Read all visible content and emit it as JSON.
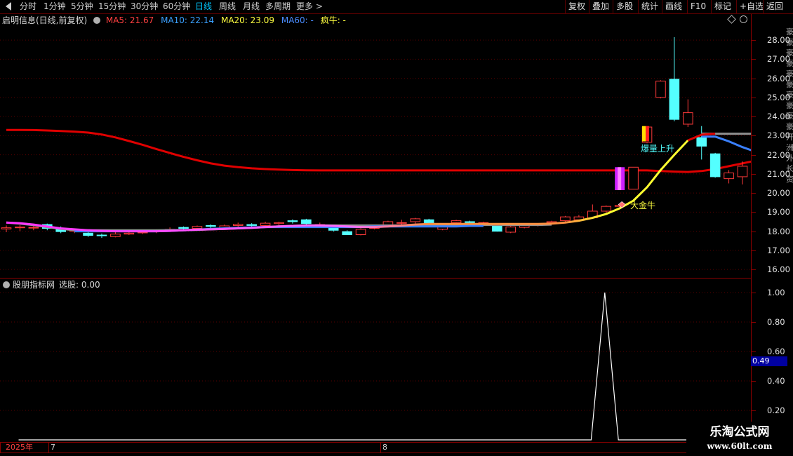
{
  "toolbar": {
    "periods": [
      {
        "label": "分时"
      },
      {
        "label": "1分钟"
      },
      {
        "label": "5分钟"
      },
      {
        "label": "15分钟"
      },
      {
        "label": "30分钟"
      },
      {
        "label": "60分钟"
      },
      {
        "label": "日线",
        "active": true
      },
      {
        "label": "周线"
      },
      {
        "label": "月线"
      },
      {
        "label": "多周期"
      },
      {
        "label": "更多 >"
      }
    ],
    "right_buttons": [
      "复权",
      "叠加",
      "多股",
      "统计",
      "画线",
      "F10",
      "标记",
      "+自选",
      "返回"
    ]
  },
  "header": {
    "stock": "启明信息(日线,前复权)",
    "ma5": "MA5: 21.67",
    "ma10": "MA10: 22.14",
    "ma20": "MA20: 23.09",
    "ma60": "MA60: -",
    "indicator": "疯牛: -"
  },
  "price_axis": {
    "labels": [
      "28.00",
      "27.00",
      "26.00",
      "25.00",
      "24.00",
      "23.00",
      "22.00",
      "21.00",
      "20.00",
      "19.00",
      "18.00",
      "17.00",
      "16.00"
    ]
  },
  "annotations": {
    "baoliang": "爆量上升",
    "dajinniu": "大金牛"
  },
  "sub_panel": {
    "title": "股朋指标网",
    "value_text": "选股: 0.00",
    "axis_labels": [
      "1.00",
      "0.80",
      "0.60",
      "0.40",
      "0.20"
    ],
    "current_value": "0.49"
  },
  "date_axis": {
    "year": "2025年",
    "months": [
      "7",
      "8"
    ]
  },
  "watermark": {
    "line1": "乐淘公式网",
    "line2": "www.60lt.com"
  },
  "colors": {
    "up": "#ff3a3a",
    "down": "#54ffff",
    "ma_long": "#e00000",
    "signal_line": "#ffffff"
  },
  "chart_data": {
    "type": "candlestick",
    "ylim": [
      15.6,
      28.7
    ],
    "candles": [
      {
        "o": 18.12,
        "c": 18.18,
        "h": 18.3,
        "l": 17.95
      },
      {
        "o": 18.18,
        "c": 18.22,
        "h": 18.32,
        "l": 18.0
      },
      {
        "o": 18.2,
        "c": 18.2,
        "h": 18.35,
        "l": 18.05
      },
      {
        "o": 18.35,
        "c": 18.15,
        "h": 18.4,
        "l": 18.05
      },
      {
        "o": 18.15,
        "c": 17.98,
        "h": 18.25,
        "l": 17.9
      },
      {
        "o": 18.0,
        "c": 18.05,
        "h": 18.15,
        "l": 17.9
      },
      {
        "o": 17.9,
        "c": 17.78,
        "h": 17.95,
        "l": 17.7
      },
      {
        "o": 17.8,
        "c": 17.78,
        "h": 17.88,
        "l": 17.65
      },
      {
        "o": 17.72,
        "c": 17.85,
        "h": 17.95,
        "l": 17.68
      },
      {
        "o": 17.85,
        "c": 17.9,
        "h": 18.0,
        "l": 17.8
      },
      {
        "o": 17.95,
        "c": 17.95,
        "h": 18.05,
        "l": 17.85
      },
      {
        "o": 17.97,
        "c": 18.02,
        "h": 18.1,
        "l": 17.9
      },
      {
        "o": 18.05,
        "c": 18.1,
        "h": 18.2,
        "l": 17.98
      },
      {
        "o": 18.2,
        "c": 18.15,
        "h": 18.25,
        "l": 18.05
      },
      {
        "o": 18.15,
        "c": 18.25,
        "h": 18.3,
        "l": 18.1
      },
      {
        "o": 18.3,
        "c": 18.25,
        "h": 18.36,
        "l": 18.15
      },
      {
        "o": 18.15,
        "c": 18.28,
        "h": 18.35,
        "l": 18.1
      },
      {
        "o": 18.3,
        "c": 18.36,
        "h": 18.45,
        "l": 18.2
      },
      {
        "o": 18.35,
        "c": 18.3,
        "h": 18.42,
        "l": 18.2
      },
      {
        "o": 18.3,
        "c": 18.42,
        "h": 18.5,
        "l": 18.2
      },
      {
        "o": 18.4,
        "c": 18.45,
        "h": 18.5,
        "l": 18.3
      },
      {
        "o": 18.55,
        "c": 18.5,
        "h": 18.62,
        "l": 18.4
      },
      {
        "o": 18.6,
        "c": 18.4,
        "h": 18.65,
        "l": 18.35
      },
      {
        "o": 18.3,
        "c": 18.35,
        "h": 18.45,
        "l": 18.2
      },
      {
        "o": 18.2,
        "c": 18.05,
        "h": 18.25,
        "l": 17.98
      },
      {
        "o": 17.98,
        "c": 17.82,
        "h": 18.05,
        "l": 17.8
      },
      {
        "o": 17.82,
        "c": 18.1,
        "h": 18.15,
        "l": 17.78
      },
      {
        "o": 18.15,
        "c": 18.3,
        "h": 18.35,
        "l": 18.1
      },
      {
        "o": 18.32,
        "c": 18.5,
        "h": 18.55,
        "l": 18.25
      },
      {
        "o": 18.45,
        "c": 18.45,
        "h": 18.6,
        "l": 18.35
      },
      {
        "o": 18.5,
        "c": 18.65,
        "h": 18.7,
        "l": 18.4
      },
      {
        "o": 18.6,
        "c": 18.35,
        "h": 18.65,
        "l": 18.3
      },
      {
        "o": 18.1,
        "c": 18.3,
        "h": 18.4,
        "l": 18.05
      },
      {
        "o": 18.45,
        "c": 18.55,
        "h": 18.6,
        "l": 18.35
      },
      {
        "o": 18.5,
        "c": 18.45,
        "h": 18.55,
        "l": 18.35
      },
      {
        "o": 18.45,
        "c": 18.45,
        "h": 18.5,
        "l": 18.35
      },
      {
        "o": 18.3,
        "c": 18.0,
        "h": 18.35,
        "l": 17.98
      },
      {
        "o": 17.95,
        "c": 18.22,
        "h": 18.3,
        "l": 17.9
      },
      {
        "o": 18.2,
        "c": 18.35,
        "h": 18.4,
        "l": 18.15
      },
      {
        "o": 18.3,
        "c": 18.35,
        "h": 18.4,
        "l": 18.25
      },
      {
        "o": 18.45,
        "c": 18.5,
        "h": 18.55,
        "l": 18.35
      },
      {
        "o": 18.55,
        "c": 18.75,
        "h": 18.8,
        "l": 18.45
      },
      {
        "o": 18.6,
        "c": 18.75,
        "h": 18.85,
        "l": 18.5
      },
      {
        "o": 18.7,
        "c": 19.05,
        "h": 19.4,
        "l": 18.65
      },
      {
        "o": 19.05,
        "c": 19.3,
        "h": 19.35,
        "l": 18.95
      },
      {
        "o": 19.3,
        "c": 19.35,
        "h": 19.4,
        "l": 19.2
      },
      {
        "o": 20.2,
        "c": 21.35,
        "h": 21.35,
        "l": 20.2
      },
      {
        "o": 22.65,
        "c": 23.45,
        "h": 23.5,
        "l": 22.6
      },
      {
        "o": 25.0,
        "c": 25.85,
        "h": 25.9,
        "l": 24.95
      },
      {
        "o": 25.95,
        "c": 23.85,
        "h": 28.15,
        "l": 23.75
      },
      {
        "o": 23.6,
        "c": 24.2,
        "h": 24.9,
        "l": 23.45
      },
      {
        "o": 22.9,
        "c": 22.45,
        "h": 23.5,
        "l": 21.75
      },
      {
        "o": 22.05,
        "c": 20.85,
        "h": 22.1,
        "l": 20.8
      },
      {
        "o": 20.75,
        "c": 21.05,
        "h": 21.2,
        "l": 20.5
      },
      {
        "o": 20.85,
        "c": 21.4,
        "h": 21.65,
        "l": 20.45
      }
    ],
    "ma_long": [
      23.3,
      23.3,
      23.29,
      23.27,
      23.24,
      23.21,
      23.16,
      23.06,
      22.91,
      22.72,
      22.52,
      22.3,
      22.09,
      21.89,
      21.71,
      21.55,
      21.43,
      21.35,
      21.29,
      21.25,
      21.22,
      21.2,
      21.19,
      21.18,
      21.18,
      21.18,
      21.18,
      21.18,
      21.18,
      21.18,
      21.18,
      21.18,
      21.18,
      21.18,
      21.18,
      21.18,
      21.18,
      21.18,
      21.18,
      21.18,
      21.18,
      21.18,
      21.18,
      21.18,
      21.18,
      21.18,
      21.18,
      21.18,
      21.15,
      21.12,
      21.1,
      21.15,
      21.25,
      21.4,
      21.55,
      21.7
    ],
    "ma_short": [
      18.45,
      18.42,
      18.35,
      18.25,
      18.15,
      18.1,
      18.05,
      18.02,
      18.0,
      18.0,
      18.0,
      18.0,
      18.02,
      18.05,
      18.08,
      18.1,
      18.12,
      18.15,
      18.18,
      18.22,
      18.25,
      18.28,
      18.3,
      18.3,
      18.28,
      18.25,
      18.22,
      18.22,
      18.25,
      18.3,
      18.35,
      18.38,
      18.38,
      18.38,
      18.38,
      18.38,
      18.38,
      18.38,
      18.38,
      18.38,
      18.4,
      18.45,
      18.55,
      18.7,
      18.9,
      19.2,
      19.6,
      20.3,
      21.2,
      22.0,
      22.75,
      23.0,
      23.05,
      23.05,
      23.05,
      23.05
    ],
    "ma10": [
      null,
      null,
      null,
      null,
      null,
      null,
      null,
      null,
      null,
      null,
      null,
      null,
      null,
      null,
      null,
      null,
      null,
      null,
      null,
      null,
      null,
      null,
      null,
      null,
      null,
      null,
      null,
      null,
      null,
      null,
      null,
      null,
      null,
      null,
      null,
      null,
      null,
      null,
      null,
      null,
      null,
      null,
      null,
      null,
      null,
      null,
      null,
      null,
      null,
      null,
      null,
      22.95,
      22.95,
      22.7,
      22.4,
      22.15
    ],
    "ma_grey": [
      null,
      null,
      null,
      null,
      null,
      null,
      null,
      null,
      null,
      null,
      null,
      null,
      null,
      null,
      null,
      null,
      null,
      null,
      null,
      null,
      null,
      null,
      null,
      null,
      null,
      null,
      null,
      null,
      null,
      null,
      null,
      null,
      null,
      null,
      null,
      null,
      null,
      null,
      null,
      null,
      null,
      null,
      null,
      null,
      null,
      null,
      null,
      null,
      null,
      null,
      null,
      23.1,
      23.1,
      23.1,
      23.1,
      23.1
    ],
    "signal": [
      0,
      0,
      0,
      0,
      0,
      0,
      0,
      0,
      0,
      0,
      0,
      0,
      0,
      0,
      0,
      0,
      0,
      0,
      0,
      0,
      0,
      0,
      0,
      0,
      0,
      0,
      0,
      0,
      0,
      0,
      0,
      0,
      0,
      0,
      0,
      0,
      0,
      0,
      0,
      0,
      0,
      0,
      0,
      1,
      0,
      0,
      0,
      0,
      0,
      0,
      0,
      0,
      0,
      0,
      0,
      0
    ]
  }
}
